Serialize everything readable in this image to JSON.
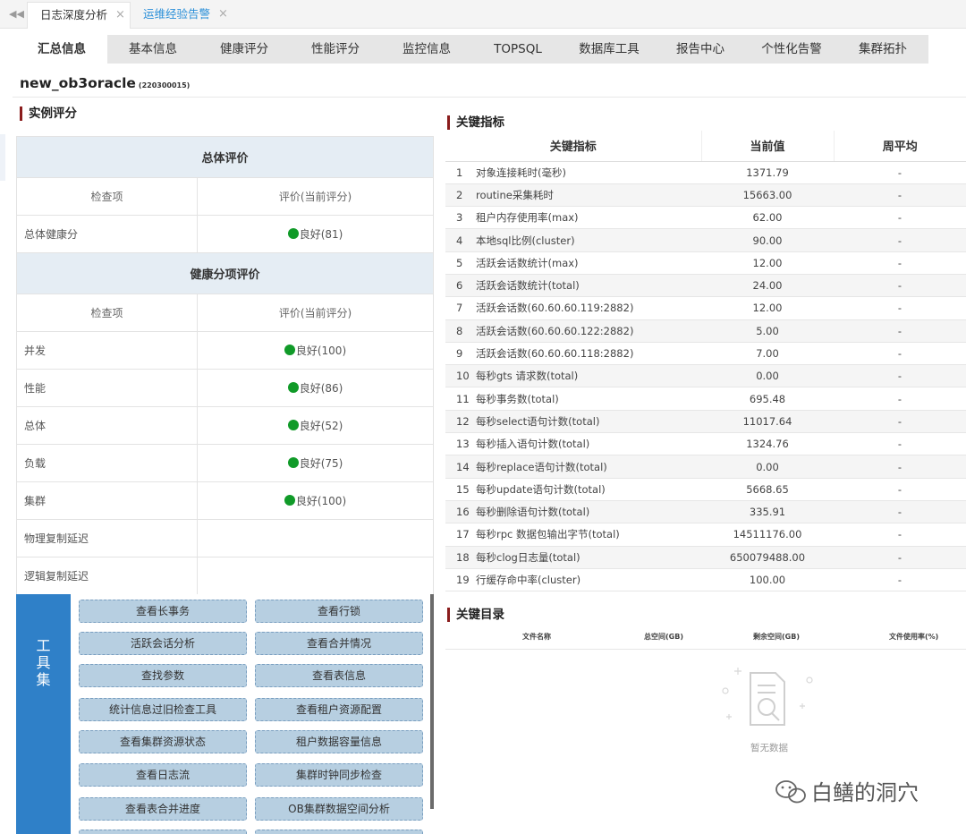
{
  "page_tabs": [
    {
      "label": "日志深度分析"
    },
    {
      "label": "运维经验告警"
    }
  ],
  "nav": [
    "汇总信息",
    "基本信息",
    "健康评分",
    "性能评分",
    "监控信息",
    "TOPSQL",
    "数据库工具",
    "报告中心",
    "个性化告警",
    "集群拓扑"
  ],
  "instance": {
    "name": "new_ob3oracle",
    "code": "(220300015)"
  },
  "score": {
    "section_title": "实例评分",
    "overall_header": "总体评价",
    "col_item": "检查项",
    "col_eval": "评价(当前评分)",
    "overall_row": {
      "name": "总体健康分",
      "value": "良好(81)",
      "status": "good"
    },
    "sub_header": "健康分项评价",
    "sub_col_item": "检查项",
    "sub_col_eval": "评价(当前评分)",
    "rows": [
      {
        "name": "并发",
        "value": "良好(100)",
        "status": "good"
      },
      {
        "name": "性能",
        "value": "良好(86)",
        "status": "good"
      },
      {
        "name": "总体",
        "value": "良好(52)",
        "status": "good"
      },
      {
        "name": "负载",
        "value": "良好(75)",
        "status": "good"
      },
      {
        "name": "集群",
        "value": "良好(100)",
        "status": "good"
      },
      {
        "name": "物理复制延迟",
        "value": "",
        "status": "none"
      },
      {
        "name": "逻辑复制延迟",
        "value": "",
        "status": "none"
      }
    ]
  },
  "tools": {
    "side_label": [
      "工",
      "具",
      "集"
    ],
    "buttons": [
      "查看长事务",
      "查看行锁",
      "活跃会话分析",
      "查看合并情况",
      "查找参数",
      "查看表信息",
      "统计信息过旧检查工具",
      "查看租户资源配置",
      "查看集群资源状态",
      "租户数据容量信息",
      "查看日志流",
      "集群时钟同步检查",
      "查看表合并进度",
      "OB集群数据空间分析"
    ]
  },
  "metrics": {
    "section_title": "关键指标",
    "columns": [
      "关键指标",
      "当前值",
      "周平均"
    ],
    "rows": [
      {
        "idx": "1",
        "name": "对象连接耗时(毫秒)",
        "value": "1371.79",
        "avg": "-"
      },
      {
        "idx": "2",
        "name": "routine采集耗时",
        "value": "15663.00",
        "avg": "-"
      },
      {
        "idx": "3",
        "name": "租户内存使用率(max)",
        "value": "62.00",
        "avg": "-"
      },
      {
        "idx": "4",
        "name": "本地sql比例(cluster)",
        "value": "90.00",
        "avg": "-"
      },
      {
        "idx": "5",
        "name": "活跃会话数统计(max)",
        "value": "12.00",
        "avg": "-"
      },
      {
        "idx": "6",
        "name": "活跃会话数统计(total)",
        "value": "24.00",
        "avg": "-"
      },
      {
        "idx": "7",
        "name": "活跃会话数(60.60.60.119:2882)",
        "value": "12.00",
        "avg": "-"
      },
      {
        "idx": "8",
        "name": "活跃会话数(60.60.60.122:2882)",
        "value": "5.00",
        "avg": "-"
      },
      {
        "idx": "9",
        "name": "活跃会话数(60.60.60.118:2882)",
        "value": "7.00",
        "avg": "-"
      },
      {
        "idx": "10",
        "name": "每秒gts 请求数(total)",
        "value": "0.00",
        "avg": "-"
      },
      {
        "idx": "11",
        "name": "每秒事务数(total)",
        "value": "695.48",
        "avg": "-"
      },
      {
        "idx": "12",
        "name": "每秒select语句计数(total)",
        "value": "11017.64",
        "avg": "-"
      },
      {
        "idx": "13",
        "name": "每秒插入语句计数(total)",
        "value": "1324.76",
        "avg": "-"
      },
      {
        "idx": "14",
        "name": "每秒replace语句计数(total)",
        "value": "0.00",
        "avg": "-"
      },
      {
        "idx": "15",
        "name": "每秒update语句计数(total)",
        "value": "5668.65",
        "avg": "-"
      },
      {
        "idx": "16",
        "name": "每秒删除语句计数(total)",
        "value": "335.91",
        "avg": "-"
      },
      {
        "idx": "17",
        "name": "每秒rpc 数据包输出字节(total)",
        "value": "14511176.00",
        "avg": "-"
      },
      {
        "idx": "18",
        "name": "每秒clog日志量(total)",
        "value": "650079488.00",
        "avg": "-"
      },
      {
        "idx": "19",
        "name": "行缓存命中率(cluster)",
        "value": "100.00",
        "avg": "-"
      }
    ]
  },
  "directory": {
    "section_title": "关键目录",
    "columns": [
      "文件名称",
      "总空间(GB)",
      "剩余空间(GB)",
      "文件使用率(%)"
    ],
    "empty_text": "暂无数据"
  },
  "watermark": "白鳝的洞穴",
  "colors": {
    "accent": "#2f80c8",
    "good": "#109a28",
    "section_bar": "#8a1c1c",
    "button": "#b7cfe1"
  }
}
